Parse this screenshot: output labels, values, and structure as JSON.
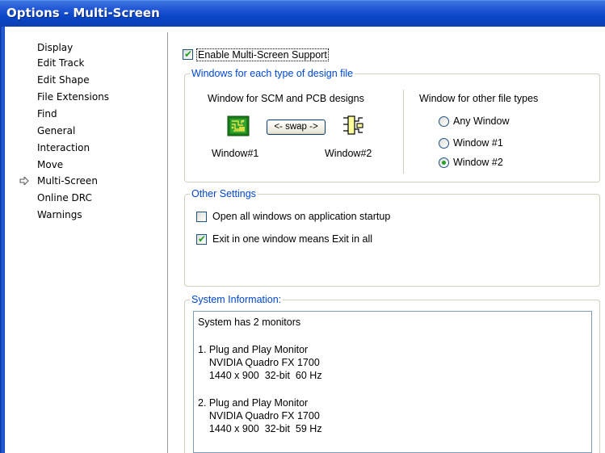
{
  "window": {
    "title": "Options - Multi-Screen"
  },
  "sidebar": {
    "items": [
      {
        "label": "Display"
      },
      {
        "label": "Edit Track"
      },
      {
        "label": "Edit Shape"
      },
      {
        "label": "File Extensions"
      },
      {
        "label": "Find"
      },
      {
        "label": "General"
      },
      {
        "label": "Interaction"
      },
      {
        "label": "Move"
      },
      {
        "label": "Multi-Screen",
        "selected": true
      },
      {
        "label": "Online DRC"
      },
      {
        "label": "Warnings"
      }
    ],
    "selected_marker_icon": "arrow-right-icon"
  },
  "main": {
    "enable_multi_screen": {
      "label": "Enable Multi-Screen Support",
      "checked": true
    },
    "windows_group": {
      "title": "Windows for each type of design file",
      "scm_pcb_title": "Window for SCM and PCB designs",
      "swap_label": "<- swap ->",
      "window1_label": "Window#1",
      "window2_label": "Window#2",
      "window1_icon": "pcb-board-icon",
      "window2_icon": "schematic-icon",
      "other_title": "Window for other file types",
      "options": [
        {
          "label": "Any Window",
          "selected": false
        },
        {
          "label": "Window #1",
          "selected": false
        },
        {
          "label": "Window #2",
          "selected": true
        }
      ]
    },
    "other_settings": {
      "title": "Other Settings",
      "open_all": {
        "label": "Open all windows on application startup",
        "checked": false
      },
      "exit_all": {
        "label": "Exit in one window means Exit in all",
        "checked": true
      }
    },
    "system_info": {
      "title": "System Information:",
      "lines": [
        "System has 2 monitors",
        "",
        "1. Plug and Play Monitor",
        "    NVIDIA Quadro FX 1700",
        "    1440 x 900  32-bit  60 Hz",
        "",
        "2. Plug and Play Monitor",
        "    NVIDIA Quadro FX 1700",
        "    1440 x 900  32-bit  59 Hz"
      ]
    }
  },
  "colors": {
    "titlebar": "#0a46c8",
    "group_title": "#0046d5",
    "check_mark": "#21a121"
  }
}
